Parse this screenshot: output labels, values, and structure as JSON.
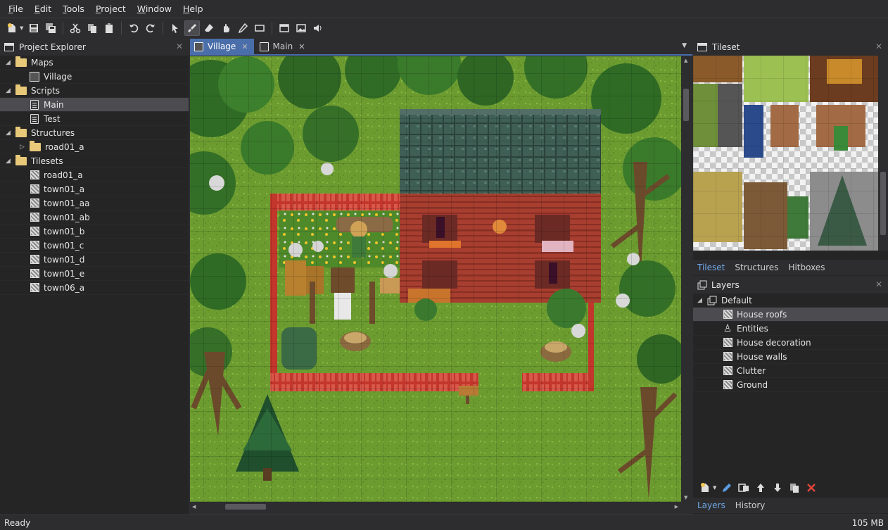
{
  "menubar": {
    "items": [
      {
        "label": "File",
        "ul": "F",
        "rest": "ile"
      },
      {
        "label": "Edit",
        "ul": "E",
        "rest": "dit"
      },
      {
        "label": "Tools",
        "ul": "T",
        "rest": "ools"
      },
      {
        "label": "Project",
        "ul": "P",
        "rest": "roject"
      },
      {
        "label": "Window",
        "ul": "W",
        "rest": "indow"
      },
      {
        "label": "Help",
        "ul": "H",
        "rest": "elp"
      }
    ]
  },
  "explorer": {
    "title": "Project Explorer",
    "tree": [
      {
        "label": "Maps",
        "type": "folder",
        "depth": 0,
        "expanded": true
      },
      {
        "label": "Village",
        "type": "map",
        "depth": 1
      },
      {
        "label": "Scripts",
        "type": "folder",
        "depth": 0,
        "expanded": true
      },
      {
        "label": "Main",
        "type": "script",
        "depth": 1,
        "selected": true
      },
      {
        "label": "Test",
        "type": "script",
        "depth": 1
      },
      {
        "label": "Structures",
        "type": "folder",
        "depth": 0,
        "expanded": true
      },
      {
        "label": "road01_a",
        "type": "folder",
        "depth": 1,
        "expanded": false
      },
      {
        "label": "Tilesets",
        "type": "folder",
        "depth": 0,
        "expanded": true
      },
      {
        "label": "road01_a",
        "type": "tileset",
        "depth": 1
      },
      {
        "label": "town01_a",
        "type": "tileset",
        "depth": 1
      },
      {
        "label": "town01_aa",
        "type": "tileset",
        "depth": 1
      },
      {
        "label": "town01_ab",
        "type": "tileset",
        "depth": 1
      },
      {
        "label": "town01_b",
        "type": "tileset",
        "depth": 1
      },
      {
        "label": "town01_c",
        "type": "tileset",
        "depth": 1
      },
      {
        "label": "town01_d",
        "type": "tileset",
        "depth": 1
      },
      {
        "label": "town01_e",
        "type": "tileset",
        "depth": 1
      },
      {
        "label": "town06_a",
        "type": "tileset",
        "depth": 1
      }
    ]
  },
  "editor": {
    "tabs": [
      {
        "label": "Village",
        "active": true
      },
      {
        "label": "Main",
        "active": false
      }
    ]
  },
  "tileset_panel": {
    "title": "Tileset",
    "tabs": [
      "Tileset",
      "Structures",
      "Hitboxes"
    ],
    "active_tab": "Tileset"
  },
  "layers_panel": {
    "title": "Layers",
    "group": "Default",
    "layers": [
      {
        "label": "House roofs",
        "icon": "tile-layer-icon",
        "selected": true
      },
      {
        "label": "Entities",
        "icon": "entity-layer-icon",
        "selected": false
      },
      {
        "label": "House decoration",
        "icon": "tile-layer-icon",
        "selected": false
      },
      {
        "label": "House walls",
        "icon": "tile-layer-icon",
        "selected": false
      },
      {
        "label": "Clutter",
        "icon": "tile-layer-icon",
        "selected": false
      },
      {
        "label": "Ground",
        "icon": "tile-layer-icon",
        "selected": false
      }
    ],
    "tabs": [
      "Layers",
      "History"
    ],
    "active_tab": "Layers"
  },
  "statusbar": {
    "left": "Ready",
    "right": "105 MB"
  },
  "colors": {
    "accent": "#4a6ea9",
    "tab_active_text": "#6fa8e6",
    "grass": "#6a9a2f",
    "fence_red": "#c0352a",
    "roof_teal": "#3c5a52",
    "wall_red": "#a63c2e"
  }
}
